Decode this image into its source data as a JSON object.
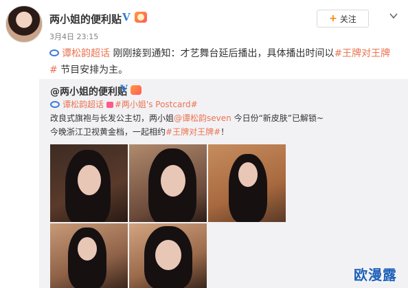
{
  "post": {
    "author": "两小姐的便利贴",
    "verified_mark": "V",
    "time": "3月4日 23:15",
    "follow_label": "关注",
    "follow_plus": "+",
    "text": {
      "topic": "谭松韵超话",
      "body_1": " 刚刚接到通知：才艺舞台延后播出，具体播出时间以",
      "hashtag": "#王牌对王牌#",
      "body_2": " 节目安排为主。"
    }
  },
  "repost": {
    "author": "@两小姐的便利贴",
    "verified_mark": "V",
    "topic": "谭松韵超话",
    "hashtag": "#两小姐's Postcard#",
    "line1_a": "改良式旗袍与长发公主切，两小姐",
    "mention": "@谭松韵seven",
    "line1_b": " 今日份“新皮肤”已解锁~",
    "line2_a": "今晚浙江卫视黄金档，一起相约",
    "line2_hashtag": "#王牌对王牌#",
    "line2_b": "！"
  },
  "photos": [
    "photo-1",
    "photo-2",
    "photo-3",
    "photo-4",
    "photo-5"
  ],
  "watermark": "欧漫露",
  "colors": {
    "link": "#eb7350",
    "verified": "#2f7fd8",
    "follow_plus": "#ff8200",
    "repost_bg": "#f2f2f5",
    "watermark": "#1d5fb8"
  }
}
